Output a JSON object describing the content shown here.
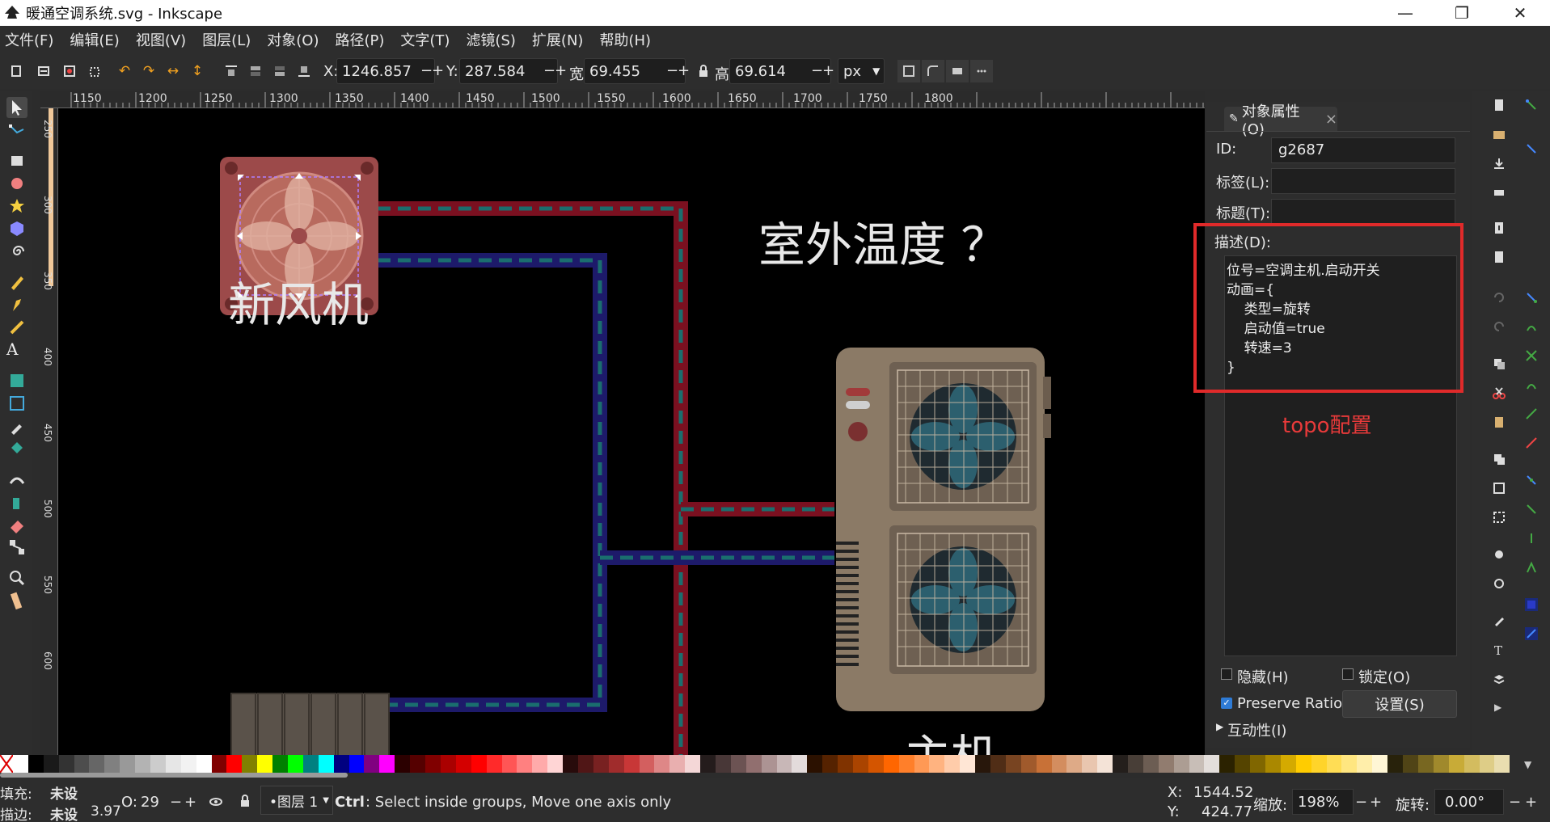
{
  "window": {
    "title": "暖通空调系统.svg - Inkscape",
    "minimize": "—",
    "maximize": "❐",
    "close": "✕"
  },
  "menu": [
    "文件(F)",
    "编辑(E)",
    "视图(V)",
    "图层(L)",
    "对象(O)",
    "路径(P)",
    "文字(T)",
    "滤镜(S)",
    "扩展(N)",
    "帮助(H)"
  ],
  "toolbar": {
    "x_label": "X:",
    "x_value": "1246.857",
    "y_label": "Y:",
    "y_value": "287.584",
    "w_label": "宽:",
    "w_value": "69.455",
    "h_label": "高:",
    "h_value": "69.614",
    "unit": "px",
    "minus": "−",
    "plus": "+"
  },
  "ruler": {
    "h_ticks": [
      "1150",
      "1200",
      "1250",
      "1300",
      "1350",
      "1400",
      "1450",
      "1500",
      "1550",
      "1600",
      "1650",
      "1700",
      "1750",
      "1800"
    ],
    "v_ticks": [
      "250",
      "300",
      "350",
      "400",
      "450",
      "500",
      "550",
      "600"
    ]
  },
  "canvas": {
    "fresh_air_label": "新风机",
    "outdoor_temp_label": "室外温度 ？",
    "main_unit_label": "主机",
    "colors": {
      "supply_pipe": "#7a1020",
      "return_pipe": "#1d1a6a",
      "dash": "#1a6e6e",
      "unit_body": "#8b7a66"
    }
  },
  "panel": {
    "tab_label": "对象属性(O)",
    "tab_close": "×",
    "id_label": "ID:",
    "id_value": "g2687",
    "tag_label": "标签(L):",
    "title_label": "标题(T):",
    "desc_label": "描述(D):",
    "description_lines": [
      "位号=空调主机.启动开关",
      "动画={",
      "    类型=旋转",
      "    启动值=true",
      "    转速=3",
      "}"
    ],
    "annotation": "topo配置",
    "hide_label": "隐藏(H)",
    "lock_label": "锁定(O)",
    "preserve_ratio_label": "Preserve Ratio",
    "set_button": "设置(S)",
    "interactivity_label": "互动性(I)"
  },
  "palette_colors": [
    "#ffffff",
    "#000000",
    "#1a1a1a",
    "#333333",
    "#4d4d4d",
    "#666666",
    "#808080",
    "#999999",
    "#b3b3b3",
    "#cccccc",
    "#e6e6e6",
    "#f2f2f2",
    "#ffffff",
    "#800000",
    "#ff0000",
    "#808000",
    "#ffff00",
    "#008000",
    "#00ff00",
    "#008080",
    "#00ffff",
    "#000080",
    "#0000ff",
    "#800080",
    "#ff00ff",
    "#2b0000",
    "#550000",
    "#800000",
    "#aa0000",
    "#d40000",
    "#ff0000",
    "#ff2a2a",
    "#ff5555",
    "#ff8080",
    "#ffaaaa",
    "#ffd5d5",
    "#280b0b",
    "#501616",
    "#782121",
    "#a02c2c",
    "#c83737",
    "#d35f5f",
    "#de8787",
    "#e9afaf",
    "#f4d7d7",
    "#241c1c",
    "#483737",
    "#6c5353",
    "#916f6f",
    "#ac9393",
    "#c8b7b7",
    "#e3dbdb",
    "#2b1100",
    "#552200",
    "#803300",
    "#aa4400",
    "#d45500",
    "#ff6600",
    "#ff7f2a",
    "#ff9955",
    "#ffb380",
    "#ffccaa",
    "#ffe6d5",
    "#28170b",
    "#502d16",
    "#784421",
    "#a05a2c",
    "#c87137",
    "#d38d5f",
    "#deaa87",
    "#e9c6af",
    "#f4e3d7",
    "#241f1c",
    "#483e37",
    "#6c5d53",
    "#917c6f",
    "#ac9d93",
    "#c8beb7",
    "#e3dedb",
    "#2b2200",
    "#554400",
    "#806600",
    "#aa8800",
    "#d4aa00",
    "#ffcc00",
    "#ffd42a",
    "#ffdd55",
    "#ffe680",
    "#ffeeaa",
    "#fff6d5",
    "#28220b",
    "#504416",
    "#786721",
    "#a0892c",
    "#c8ab37",
    "#d3bc5f",
    "#decd87",
    "#e9ddaf"
  ],
  "status": {
    "fill_label": "填充:",
    "fill_value": "未设",
    "stroke_label": "描边:",
    "stroke_value": "未设",
    "stroke_width": "3.97",
    "opacity_label": "O:",
    "opacity_value": "29",
    "layer": "•图层 1",
    "hint_bold": "Ctrl",
    "hint": ": Select inside groups, Move one axis only",
    "cursor_x_label": "X:",
    "cursor_x": "1544.52",
    "cursor_y_label": "Y:",
    "cursor_y": "424.77",
    "zoom_label": "缩放:",
    "zoom_value": "198%",
    "rotate_label": "旋转:",
    "rotate_value": "0.00°"
  }
}
